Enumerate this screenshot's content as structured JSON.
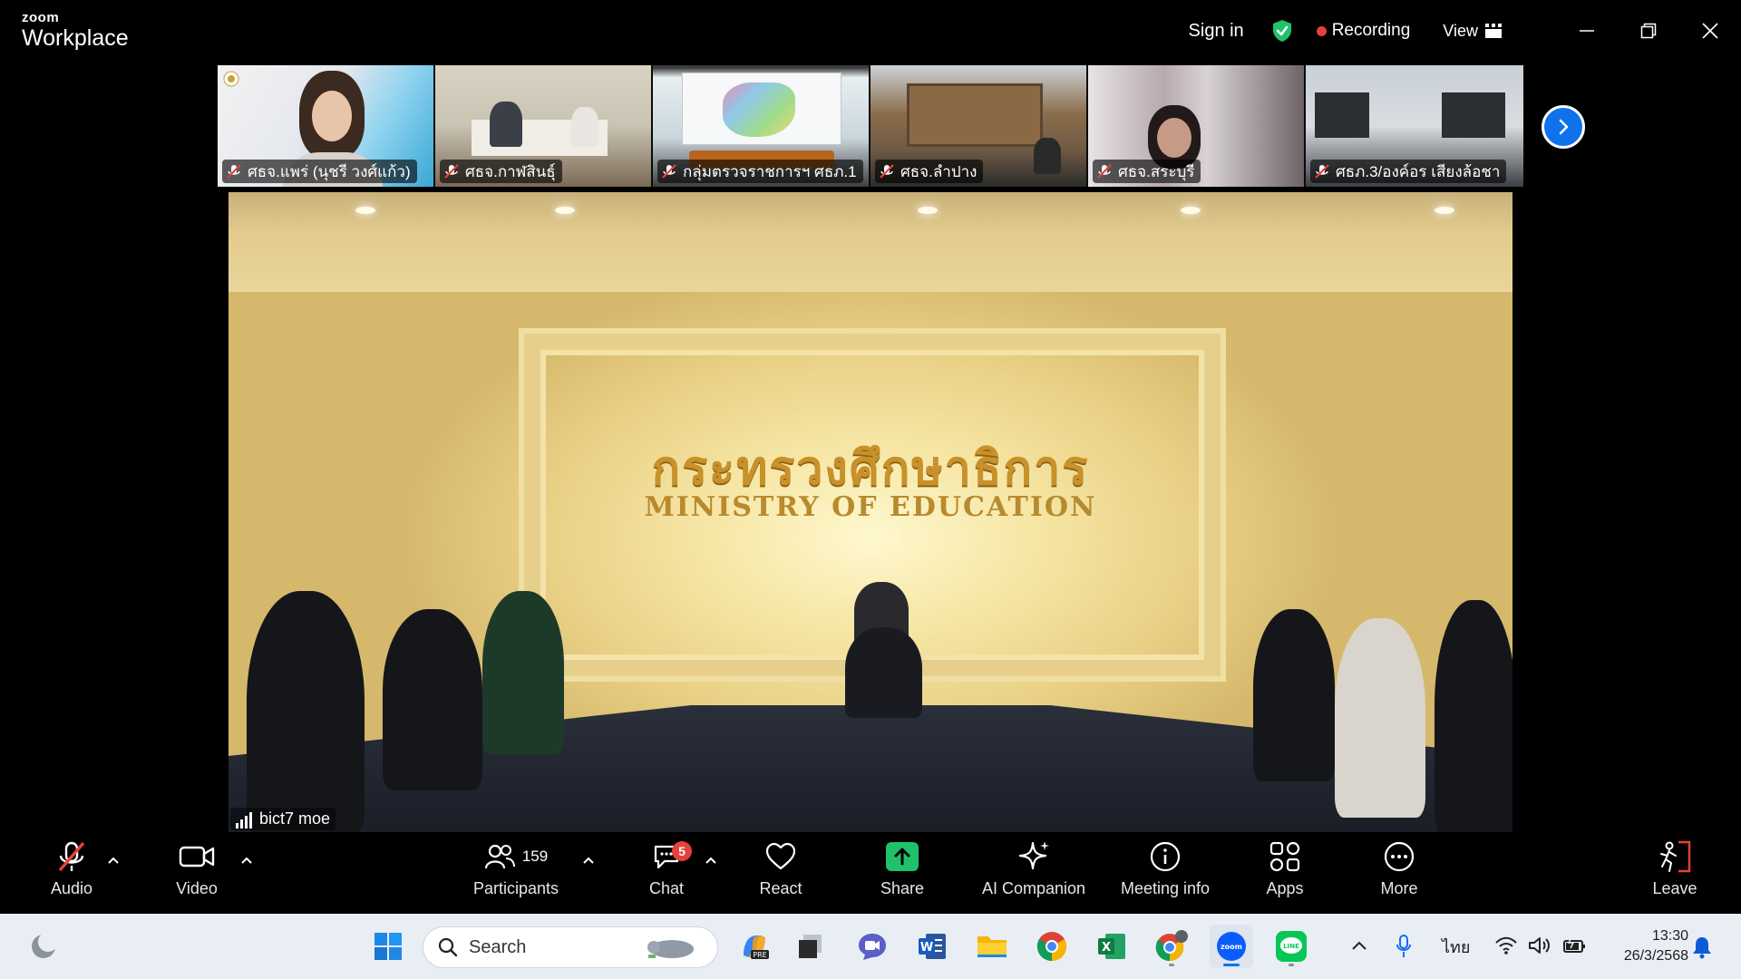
{
  "titlebar": {
    "brand_top": "zoom",
    "brand_bottom": "Workplace",
    "sign_in": "Sign in",
    "recording": "Recording",
    "view": "View"
  },
  "participants": [
    {
      "name": "ศธจ.แพร่ (นุชรี วงศ์แก้ว)",
      "muted": true
    },
    {
      "name": "ศธจ.กาฬสินธุ์",
      "muted": true
    },
    {
      "name": "กลุ่มตรวจราชการฯ ศธภ.1",
      "muted": true
    },
    {
      "name": "ศธจ.ลำปาง",
      "muted": true
    },
    {
      "name": "ศธจ.สระบุรี",
      "muted": true
    },
    {
      "name": "ศธภ.3/องค์อร เสียงล้อชา",
      "muted": true
    }
  ],
  "main_video": {
    "sign_thai": "กระทรวงศึกษาธิการ",
    "sign_english": "MINISTRY OF EDUCATION",
    "speaker": "bict7 moe"
  },
  "toolbar": {
    "audio": "Audio",
    "video": "Video",
    "participants": "Participants",
    "participants_count": "159",
    "chat": "Chat",
    "chat_badge": "5",
    "react": "React",
    "share": "Share",
    "ai_companion": "AI Companion",
    "meeting_info": "Meeting info",
    "apps": "Apps",
    "more": "More",
    "leave": "Leave"
  },
  "taskbar": {
    "search_placeholder": "Search",
    "language": "ไทย",
    "time": "13:30",
    "date": "26/3/2568"
  },
  "colors": {
    "zoom_blue": "#0e72ed",
    "record_red": "#e5413a",
    "share_green": "#1fc26b",
    "mute_red": "#e5413a"
  }
}
